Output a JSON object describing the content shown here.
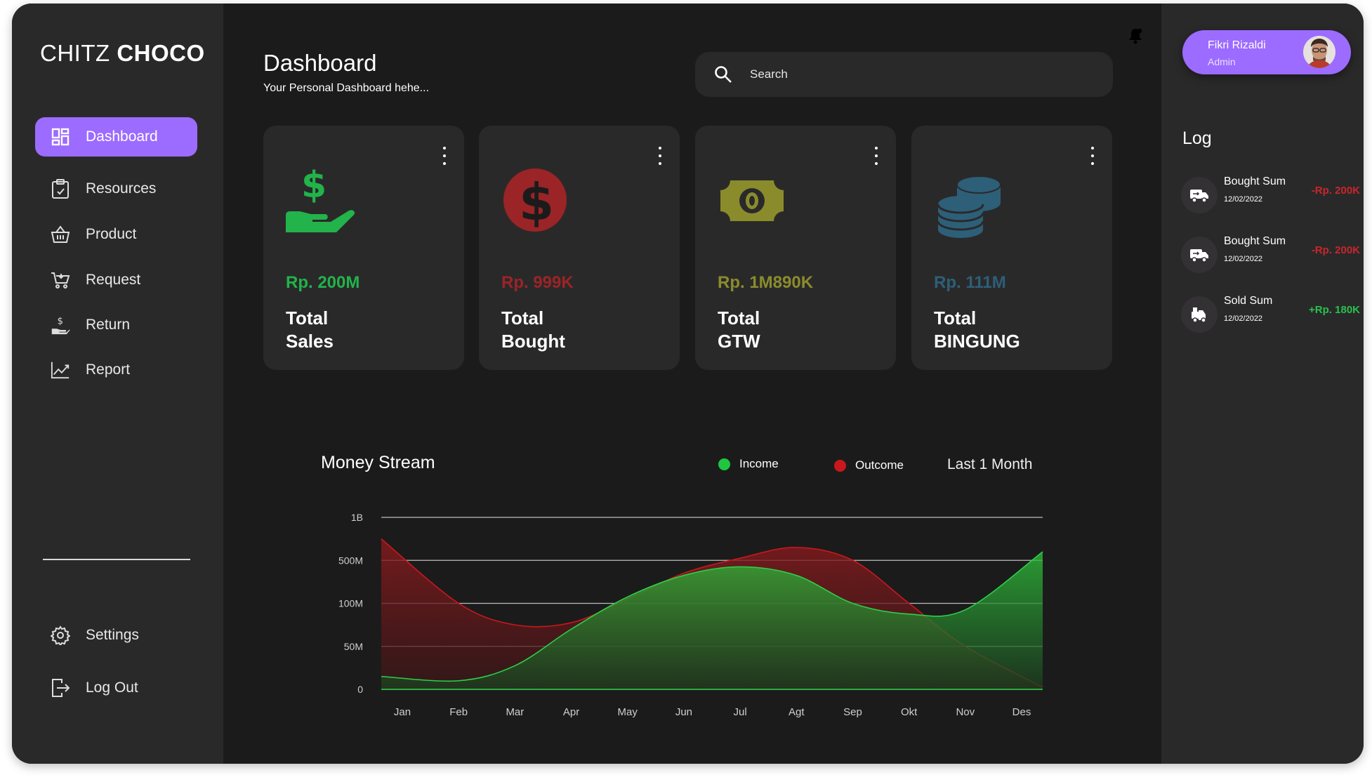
{
  "brand": {
    "light": "CHITZ ",
    "bold": "CHOCO"
  },
  "nav": {
    "dashboard": "Dashboard",
    "resources": "Resources",
    "product": "Product",
    "request": "Request",
    "return": "Return",
    "report": "Report",
    "settings": "Settings",
    "logout": "Log Out"
  },
  "header": {
    "title": "Dashboard",
    "subtitle": "Your Personal Dashboard hehe...",
    "search_placeholder": "Search"
  },
  "cards": [
    {
      "value": "Rp. 200M",
      "label": "Total\nSales",
      "color": "#22b34a",
      "icon": "hand-dollar-icon"
    },
    {
      "value": "Rp. 999K",
      "label": "Total\nBought",
      "color": "#9b2426",
      "icon": "dollar-circle-icon"
    },
    {
      "value": "Rp. 1M890K",
      "label": "Total\nGTW",
      "color": "#8a8c2c",
      "icon": "banknote-icon"
    },
    {
      "value": "Rp. 111M",
      "label": "Total\nBINGUNG",
      "color": "#2d5f78",
      "icon": "coins-icon"
    }
  ],
  "profile": {
    "name": "Fikri Rizaldi",
    "role": "Admin"
  },
  "log": {
    "title": "Log",
    "items": [
      {
        "title": "Bought Sum",
        "date": "12/02/2022",
        "value": "-Rp. 200K",
        "color": "#c8262c",
        "icon": "truck-icon"
      },
      {
        "title": "Bought Sum",
        "date": "12/02/2022",
        "value": "-Rp. 200K",
        "color": "#c8262c",
        "icon": "truck-icon"
      },
      {
        "title": "Sold  Sum",
        "date": "12/02/2022",
        "value": "+Rp. 180K",
        "color": "#27c24c",
        "icon": "delivery-icon"
      }
    ]
  },
  "chart_data": {
    "type": "area",
    "title": "Money Stream",
    "period": "Last 1 Month",
    "x": [
      "Jan",
      "Feb",
      "Mar",
      "Apr",
      "May",
      "Jun",
      "Jul",
      "Agt",
      "Sep",
      "Okt",
      "Nov",
      "Des"
    ],
    "y_ticks": [
      "0",
      "50M",
      "100M",
      "500M",
      "1B"
    ],
    "series": [
      {
        "name": "Income",
        "color": "#1fc63f",
        "values": [
          0.3,
          0.2,
          0.55,
          1.4,
          2.15,
          2.65,
          2.85,
          2.65,
          2.0,
          1.75,
          1.85,
          3.2
        ]
      },
      {
        "name": "Outcome",
        "color": "#c8181c",
        "values": [
          3.5,
          2.0,
          1.5,
          1.55,
          2.1,
          2.7,
          3.05,
          3.3,
          3.0,
          2.0,
          1.0,
          0.05
        ]
      }
    ]
  }
}
